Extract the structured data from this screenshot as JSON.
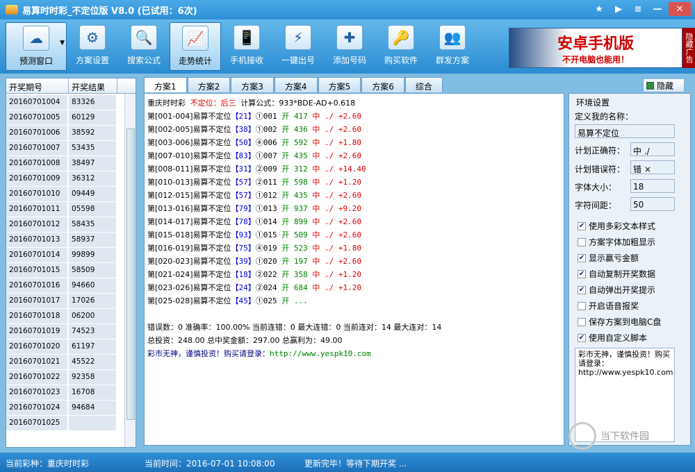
{
  "title": "易算时时彩_不定位版 V8.0 (已试用：6次)",
  "window_buttons": [
    "★",
    "▶",
    "≡",
    "—",
    "✕"
  ],
  "toolbar": [
    {
      "label": "预测窗口",
      "icon": "☁"
    },
    {
      "label": "方案设置",
      "icon": "⚙"
    },
    {
      "label": "搜索公式",
      "icon": "🔍"
    },
    {
      "label": "走势统计",
      "icon": "📈"
    },
    {
      "label": "手机接收",
      "icon": "📱"
    },
    {
      "label": "一键出号",
      "icon": "⚡"
    },
    {
      "label": "添加号码",
      "icon": "✚"
    },
    {
      "label": "购买软件",
      "icon": "🔑"
    },
    {
      "label": "群发方案",
      "icon": "👥"
    }
  ],
  "ad": {
    "line1": "安卓手机版",
    "line2": "不开电脑也能用！",
    "hide": "隐藏广告"
  },
  "left": {
    "col1": "开奖期号",
    "col2": "开奖结果",
    "rows": [
      [
        "20160701004",
        "83326"
      ],
      [
        "20160701005",
        "60129"
      ],
      [
        "20160701006",
        "38592"
      ],
      [
        "20160701007",
        "53435"
      ],
      [
        "20160701008",
        "38497"
      ],
      [
        "20160701009",
        "36312"
      ],
      [
        "20160701010",
        "09449"
      ],
      [
        "20160701011",
        "05598"
      ],
      [
        "20160701012",
        "58435"
      ],
      [
        "20160701013",
        "58937"
      ],
      [
        "20160701014",
        "99899"
      ],
      [
        "20160701015",
        "58509"
      ],
      [
        "20160701016",
        "94660"
      ],
      [
        "20160701017",
        "17026"
      ],
      [
        "20160701018",
        "06200"
      ],
      [
        "20160701019",
        "74523"
      ],
      [
        "20160701020",
        "61197"
      ],
      [
        "20160701021",
        "45522"
      ],
      [
        "20160701022",
        "92358"
      ],
      [
        "20160701023",
        "16708"
      ],
      [
        "20160701024",
        "94684"
      ],
      [
        "20160701025",
        ""
      ]
    ]
  },
  "tabs": [
    "方案1",
    "方案2",
    "方案3",
    "方案4",
    "方案5",
    "方案6",
    "综合"
  ],
  "hide_btn": "隐藏",
  "main": {
    "h_lottery": "重庆时时彩",
    "h_type": "不定位：后三",
    "h_formula": "计算公式：933*BDE-AD+0.618",
    "rows": [
      [
        "第[001-004]",
        "易算不定位",
        "【21】",
        "①001",
        "开 417",
        "中 ./",
        "+2.60"
      ],
      [
        "第[002-005]",
        "易算不定位",
        "【38】",
        "①002",
        "开 436",
        "中 ./",
        "+2.60"
      ],
      [
        "第[003-006]",
        "易算不定位",
        "【50】",
        "④006",
        "开 592",
        "中 ./",
        "+1.80"
      ],
      [
        "第[007-010]",
        "易算不定位",
        "【83】",
        "①007",
        "开 435",
        "中 ./",
        "+2.60"
      ],
      [
        "第[008-011]",
        "易算不定位",
        "【31】",
        "②009",
        "开 312",
        "中 ./",
        "+14.40"
      ],
      [
        "第[010-013]",
        "易算不定位",
        "【57】",
        "②011",
        "开 598",
        "中 ./",
        "+1.20"
      ],
      [
        "第[012-015]",
        "易算不定位",
        "【57】",
        "①012",
        "开 435",
        "中 ./",
        "+2.60"
      ],
      [
        "第[013-016]",
        "易算不定位",
        "【79】",
        "①013",
        "开 937",
        "中 ./",
        "+9.20"
      ],
      [
        "第[014-017]",
        "易算不定位",
        "【78】",
        "①014",
        "开 899",
        "中 ./",
        "+2.60"
      ],
      [
        "第[015-018]",
        "易算不定位",
        "【93】",
        "①015",
        "开 509",
        "中 ./",
        "+2.60"
      ],
      [
        "第[016-019]",
        "易算不定位",
        "【75】",
        "④019",
        "开 523",
        "中 ./",
        "+1.80"
      ],
      [
        "第[020-023]",
        "易算不定位",
        "【39】",
        "①020",
        "开 197",
        "中 ./",
        "+2.60"
      ],
      [
        "第[021-024]",
        "易算不定位",
        "【18】",
        "②022",
        "开 358",
        "中 ./",
        "+1.20"
      ],
      [
        "第[023-026]",
        "易算不定位",
        "【24】",
        "②024",
        "开 684",
        "中 ./",
        "+1.20"
      ],
      [
        "第[025-028]",
        "易算不定位",
        "【45】",
        "①025",
        "开 ...",
        "",
        ""
      ]
    ],
    "stats1": "错误数：0 准确率：100.00% 当前连错：0 最大连错：0 当前连对：14 最大连对：14",
    "stats2": "总投资：248.00 总中奖金额：297.00 总赢利为：49.00",
    "footer_warn": "彩市无神，谨慎投资！购买请登录：",
    "footer_url": "http://www.yespk10.com"
  },
  "settings": {
    "title": "环境设置",
    "name_label": "定义我的名称：",
    "name_value": "易算不定位",
    "right_label": "计划正确符：",
    "right_value": "中 ./",
    "wrong_label": "计划错误符：",
    "wrong_value": "错 ×",
    "font_label": "字体大小：",
    "font_value": "18",
    "spacing_label": "字符间距：",
    "spacing_value": "50",
    "checks": [
      {
        "label": "使用多彩文本样式",
        "checked": "✔"
      },
      {
        "label": "方案字体加粗显示",
        "checked": ""
      },
      {
        "label": "显示赢亏金额",
        "checked": "✔"
      },
      {
        "label": "自动复制开奖数据",
        "checked": "✔"
      },
      {
        "label": "自动弹出开奖提示",
        "checked": "✔"
      },
      {
        "label": "开启语音报奖",
        "checked": ""
      },
      {
        "label": "保存方案到电脑C盘",
        "checked": ""
      },
      {
        "label": "使用自定义脚本",
        "checked": "✔"
      }
    ],
    "note": "彩市无神，谨慎投资！购买请登录：http://www.yespk10.com"
  },
  "status": {
    "lottery": "当前彩种：重庆时时彩",
    "time": "当前时间：2016-07-01 10:08:00",
    "msg": "更新完毕！等待下期开奖 ..."
  },
  "watermark": "当下软件园"
}
